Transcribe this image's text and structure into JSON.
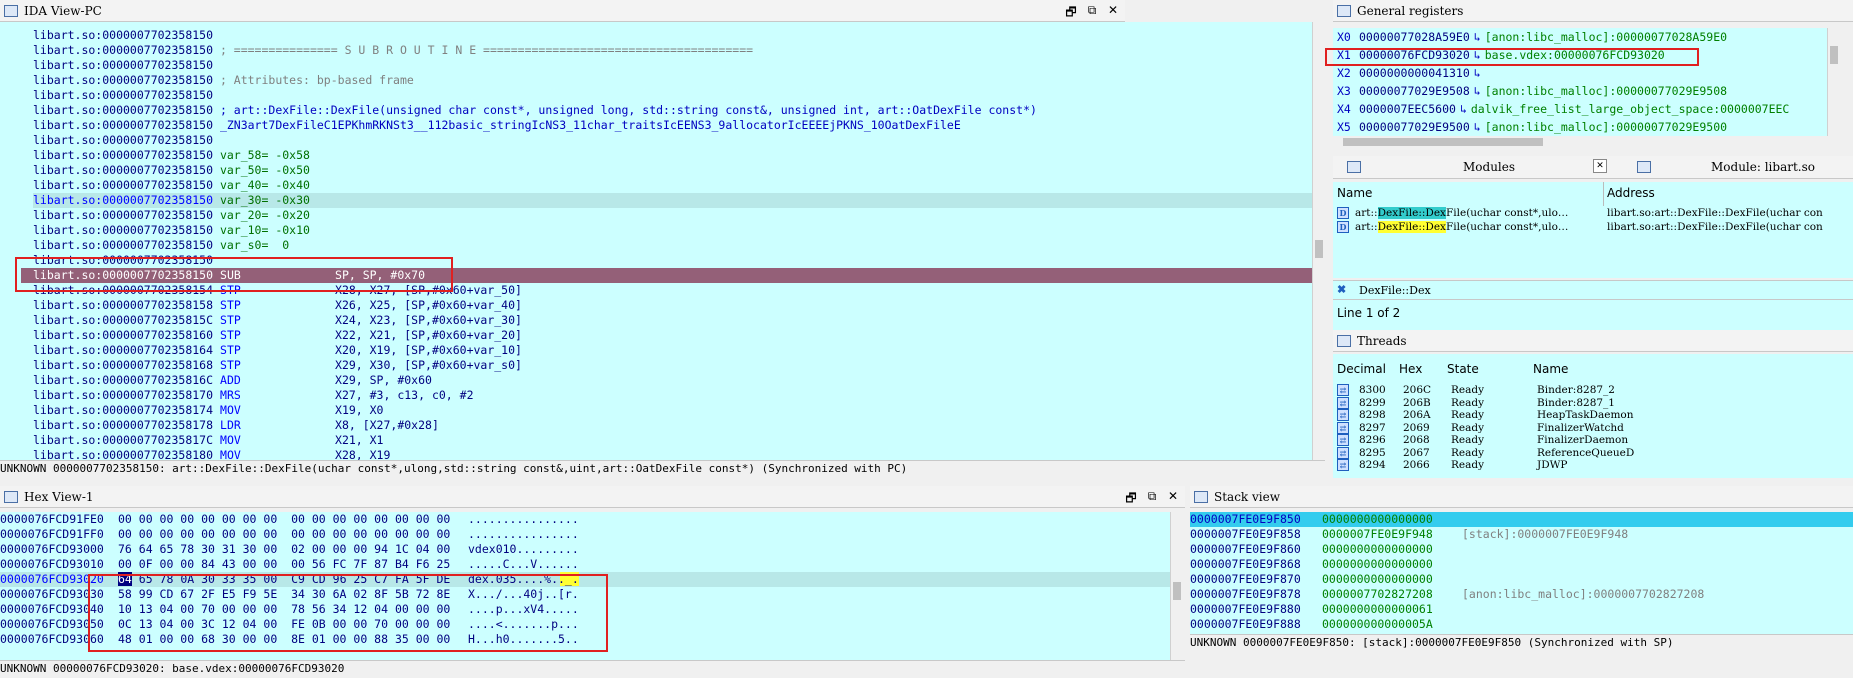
{
  "ida": {
    "title": "IDA View-PC",
    "btn_restore": "🗗",
    "btn_float": "⧉",
    "btn_close": "✕",
    "lines": [
      {
        "addr": "libart.so:0000007702358150",
        "tail": "",
        "cls": ""
      },
      {
        "addr": "libart.so:0000007702358150",
        "tail": " ; =============== S U B R O U T I N E =======================================",
        "cls": "cm"
      },
      {
        "addr": "libart.so:0000007702358150",
        "tail": "",
        "cls": ""
      },
      {
        "addr": "libart.so:0000007702358150",
        "tail": " ; Attributes: bp-based frame",
        "cls": "cm"
      },
      {
        "addr": "libart.so:0000007702358150",
        "tail": "",
        "cls": ""
      },
      {
        "addr": "libart.so:0000007702358150",
        "tail": " ; art::DexFile::DexFile(unsigned char const*, unsigned long, std::string const&, unsigned int, art::OatDexFile const*)",
        "cls": "lbl"
      },
      {
        "addr": "libart.so:0000007702358150",
        "tail": " _ZN3art7DexFileC1EPKhmRKNSt3__112basic_stringIcNS3_11char_traitsIcEENS3_9allocatorIcEEEEjPKNS_10OatDexFileE",
        "cls": "lbl"
      },
      {
        "addr": "libart.so:0000007702358150",
        "tail": "",
        "cls": ""
      },
      {
        "addr": "libart.so:0000007702358150",
        "tail": " var_58= -0x58",
        "cls": "grn"
      },
      {
        "addr": "libart.so:0000007702358150",
        "tail": " var_50= -0x50",
        "cls": "grn"
      },
      {
        "addr": "libart.so:0000007702358150",
        "tail": " var_40= -0x40",
        "cls": "grn"
      },
      {
        "addr": "libart.so:0000007702358150",
        "tail": " var_30= -0x30",
        "cls": "grn"
      },
      {
        "addr": "libart.so:0000007702358150",
        "tail": " var_20= -0x20",
        "cls": "grn"
      },
      {
        "addr": "libart.so:0000007702358150",
        "tail": " var_10= -0x10",
        "cls": "grn"
      },
      {
        "addr": "libart.so:0000007702358150",
        "tail": " var_s0=  0",
        "cls": "grn"
      },
      {
        "addr": "libart.so:0000007702358150",
        "tail": "",
        "cls": ""
      },
      {
        "addr": "libart.so:0000007702358150",
        "mn": "SUB",
        "ops": "SP, SP, #0x70"
      },
      {
        "addr": "libart.so:0000007702358154",
        "mn": "STP",
        "ops": "X28, X27, [SP,#0x60+var_50]"
      },
      {
        "addr": "libart.so:0000007702358158",
        "mn": "STP",
        "ops": "X26, X25, [SP,#0x60+var_40]"
      },
      {
        "addr": "libart.so:000000770235815C",
        "mn": "STP",
        "ops": "X24, X23, [SP,#0x60+var_30]"
      },
      {
        "addr": "libart.so:0000007702358160",
        "mn": "STP",
        "ops": "X22, X21, [SP,#0x60+var_20]"
      },
      {
        "addr": "libart.so:0000007702358164",
        "mn": "STP",
        "ops": "X20, X19, [SP,#0x60+var_10]"
      },
      {
        "addr": "libart.so:0000007702358168",
        "mn": "STP",
        "ops": "X29, X30, [SP,#0x60+var_s0]"
      },
      {
        "addr": "libart.so:000000770235816C",
        "mn": "ADD",
        "ops": "X29, SP, #0x60"
      },
      {
        "addr": "libart.so:0000007702358170",
        "mn": "MRS",
        "ops": "X27, #3, c13, c0, #2"
      },
      {
        "addr": "libart.so:0000007702358174",
        "mn": "MOV",
        "ops": "X19, X0"
      },
      {
        "addr": "libart.so:0000007702358178",
        "mn": "LDR",
        "ops": "X8, [X27,#0x28]"
      },
      {
        "addr": "libart.so:000000770235817C",
        "mn": "MOV",
        "ops": "X21, X1"
      },
      {
        "addr": "libart.so:0000007702358180",
        "mn": "MOV",
        "ops": "X28, X19"
      }
    ],
    "status": "UNKNOWN 0000007702358150: art::DexFile::DexFile(uchar const*,ulong,std::string const&,uint,art::OatDexFile const*) (Synchronized with PC)"
  },
  "regs": {
    "title": "General registers",
    "items": [
      {
        "n": "X0",
        "v": "00000077028A59E0",
        "l": "[anon:libc_malloc]:00000077028A59E0"
      },
      {
        "n": "X1",
        "v": "00000076FCD93020",
        "l": "base.vdex:00000076FCD93020"
      },
      {
        "n": "X2",
        "v": "0000000000041310",
        "l": ""
      },
      {
        "n": "X3",
        "v": "00000077029E9508",
        "l": "[anon:libc_malloc]:00000077029E9508"
      },
      {
        "n": "X4",
        "v": "0000007EEC5600",
        "l": "dalvik_free_list_large_object_space:0000007EEC"
      },
      {
        "n": "X5",
        "v": "00000077029E9500",
        "l": "[anon:libc_malloc]:00000077029E9500"
      }
    ],
    "arrow": "↳"
  },
  "modules": {
    "tab_label": "Modules",
    "tab2_label": "Module: libart.so",
    "col_name": "Name",
    "col_addr": "Address",
    "rows": [
      {
        "pre": "art::",
        "hl": "DexFile::Dex",
        "post": "File(uchar const*,ulo…",
        "addr": "libart.so:art::DexFile::DexFile(uchar con"
      },
      {
        "pre": "art::",
        "hl": "DexFile::Dex",
        "post": "File(uchar const*,ulo…",
        "addr": "libart.so:art::DexFile::DexFile(uchar con"
      }
    ],
    "filter": "DexFile::Dex",
    "line_count": "Line 1 of 2"
  },
  "threads": {
    "title": "Threads",
    "cols": [
      "Decimal",
      "Hex",
      "State",
      "Name"
    ],
    "rows": [
      {
        "d": "8300",
        "h": "206C",
        "s": "Ready",
        "n": "Binder:8287_2"
      },
      {
        "d": "8299",
        "h": "206B",
        "s": "Ready",
        "n": "Binder:8287_1"
      },
      {
        "d": "8298",
        "h": "206A",
        "s": "Ready",
        "n": "HeapTaskDaemon"
      },
      {
        "d": "8297",
        "h": "2069",
        "s": "Ready",
        "n": "FinalizerWatchd"
      },
      {
        "d": "8296",
        "h": "2068",
        "s": "Ready",
        "n": "FinalizerDaemon"
      },
      {
        "d": "8295",
        "h": "2067",
        "s": "Ready",
        "n": "ReferenceQueueD"
      },
      {
        "d": "8294",
        "h": "2066",
        "s": "Ready",
        "n": "JDWP"
      }
    ]
  },
  "hex": {
    "title": "Hex View-1",
    "lines": [
      {
        "a": "0000076FCD91FE0",
        "b": "00 00 00 00 00 00 00 00  00 00 00 00 00 00 00 00",
        "t": "................"
      },
      {
        "a": "0000076FCD91FF0",
        "b": "00 00 00 00 00 00 00 00  00 00 00 00 00 00 00 00",
        "t": "................"
      },
      {
        "a": "0000076FCD93000",
        "b": "76 64 65 78 30 31 30 00  02 00 00 00 94 1C 04 00",
        "t": "vdex010........."
      },
      {
        "a": "0000076FCD93010",
        "b": "00 0F 00 00 84 43 00 00  00 56 FC 7F 87 B4 F6 25",
        "t": ".....C...V......"
      },
      {
        "a": "0000076FCD93020",
        "b": "64 65 78 0A 30 33 35 00  C9 CD 96 25 C7 FA 5F DE",
        "t": "dex.035....%.._."
      },
      {
        "a": "0000076FCD93030",
        "b": "58 99 CD 67 2F E5 F9 5E  34 30 6A 02 8F 5B 72 8E",
        "t": "X.../...40j..[r."
      },
      {
        "a": "0000076FCD93040",
        "b": "10 13 04 00 70 00 00 00  78 56 34 12 04 00 00 00",
        "t": "....p...xV4....."
      },
      {
        "a": "0000076FCD93050",
        "b": "0C 13 04 00 3C 12 04 00  FE 0B 00 00 70 00 00 00",
        "t": "....<.......p..."
      },
      {
        "a": "0000076FCD93060",
        "b": "48 01 00 00 68 30 00 00  8E 01 00 00 88 35 00 00",
        "t": "H...h0.......5.."
      }
    ],
    "status": "UNKNOWN 00000076FCD93020: base.vdex:00000076FCD93020"
  },
  "stack": {
    "title": "Stack view",
    "lines": [
      {
        "a": "0000007FE0E9F850",
        "v": "0000000000000000",
        "c": ""
      },
      {
        "a": "0000007FE0E9F858",
        "v": "0000007FE0E9F948",
        "c": "[stack]:0000007FE0E9F948"
      },
      {
        "a": "0000007FE0E9F860",
        "v": "0000000000000000",
        "c": ""
      },
      {
        "a": "0000007FE0E9F868",
        "v": "0000000000000000",
        "c": ""
      },
      {
        "a": "0000007FE0E9F870",
        "v": "0000000000000000",
        "c": ""
      },
      {
        "a": "0000007FE0E9F878",
        "v": "0000007702827208",
        "c": "[anon:libc_malloc]:0000007702827208"
      },
      {
        "a": "0000007FE0E9F880",
        "v": "0000000000000061",
        "c": ""
      },
      {
        "a": "0000007FE0E9F888",
        "v": "000000000000005A",
        "c": ""
      }
    ],
    "status": "UNKNOWN 0000007FE0E9F850: [stack]:0000007FE0E9F850 (Synchronized with SP)"
  }
}
